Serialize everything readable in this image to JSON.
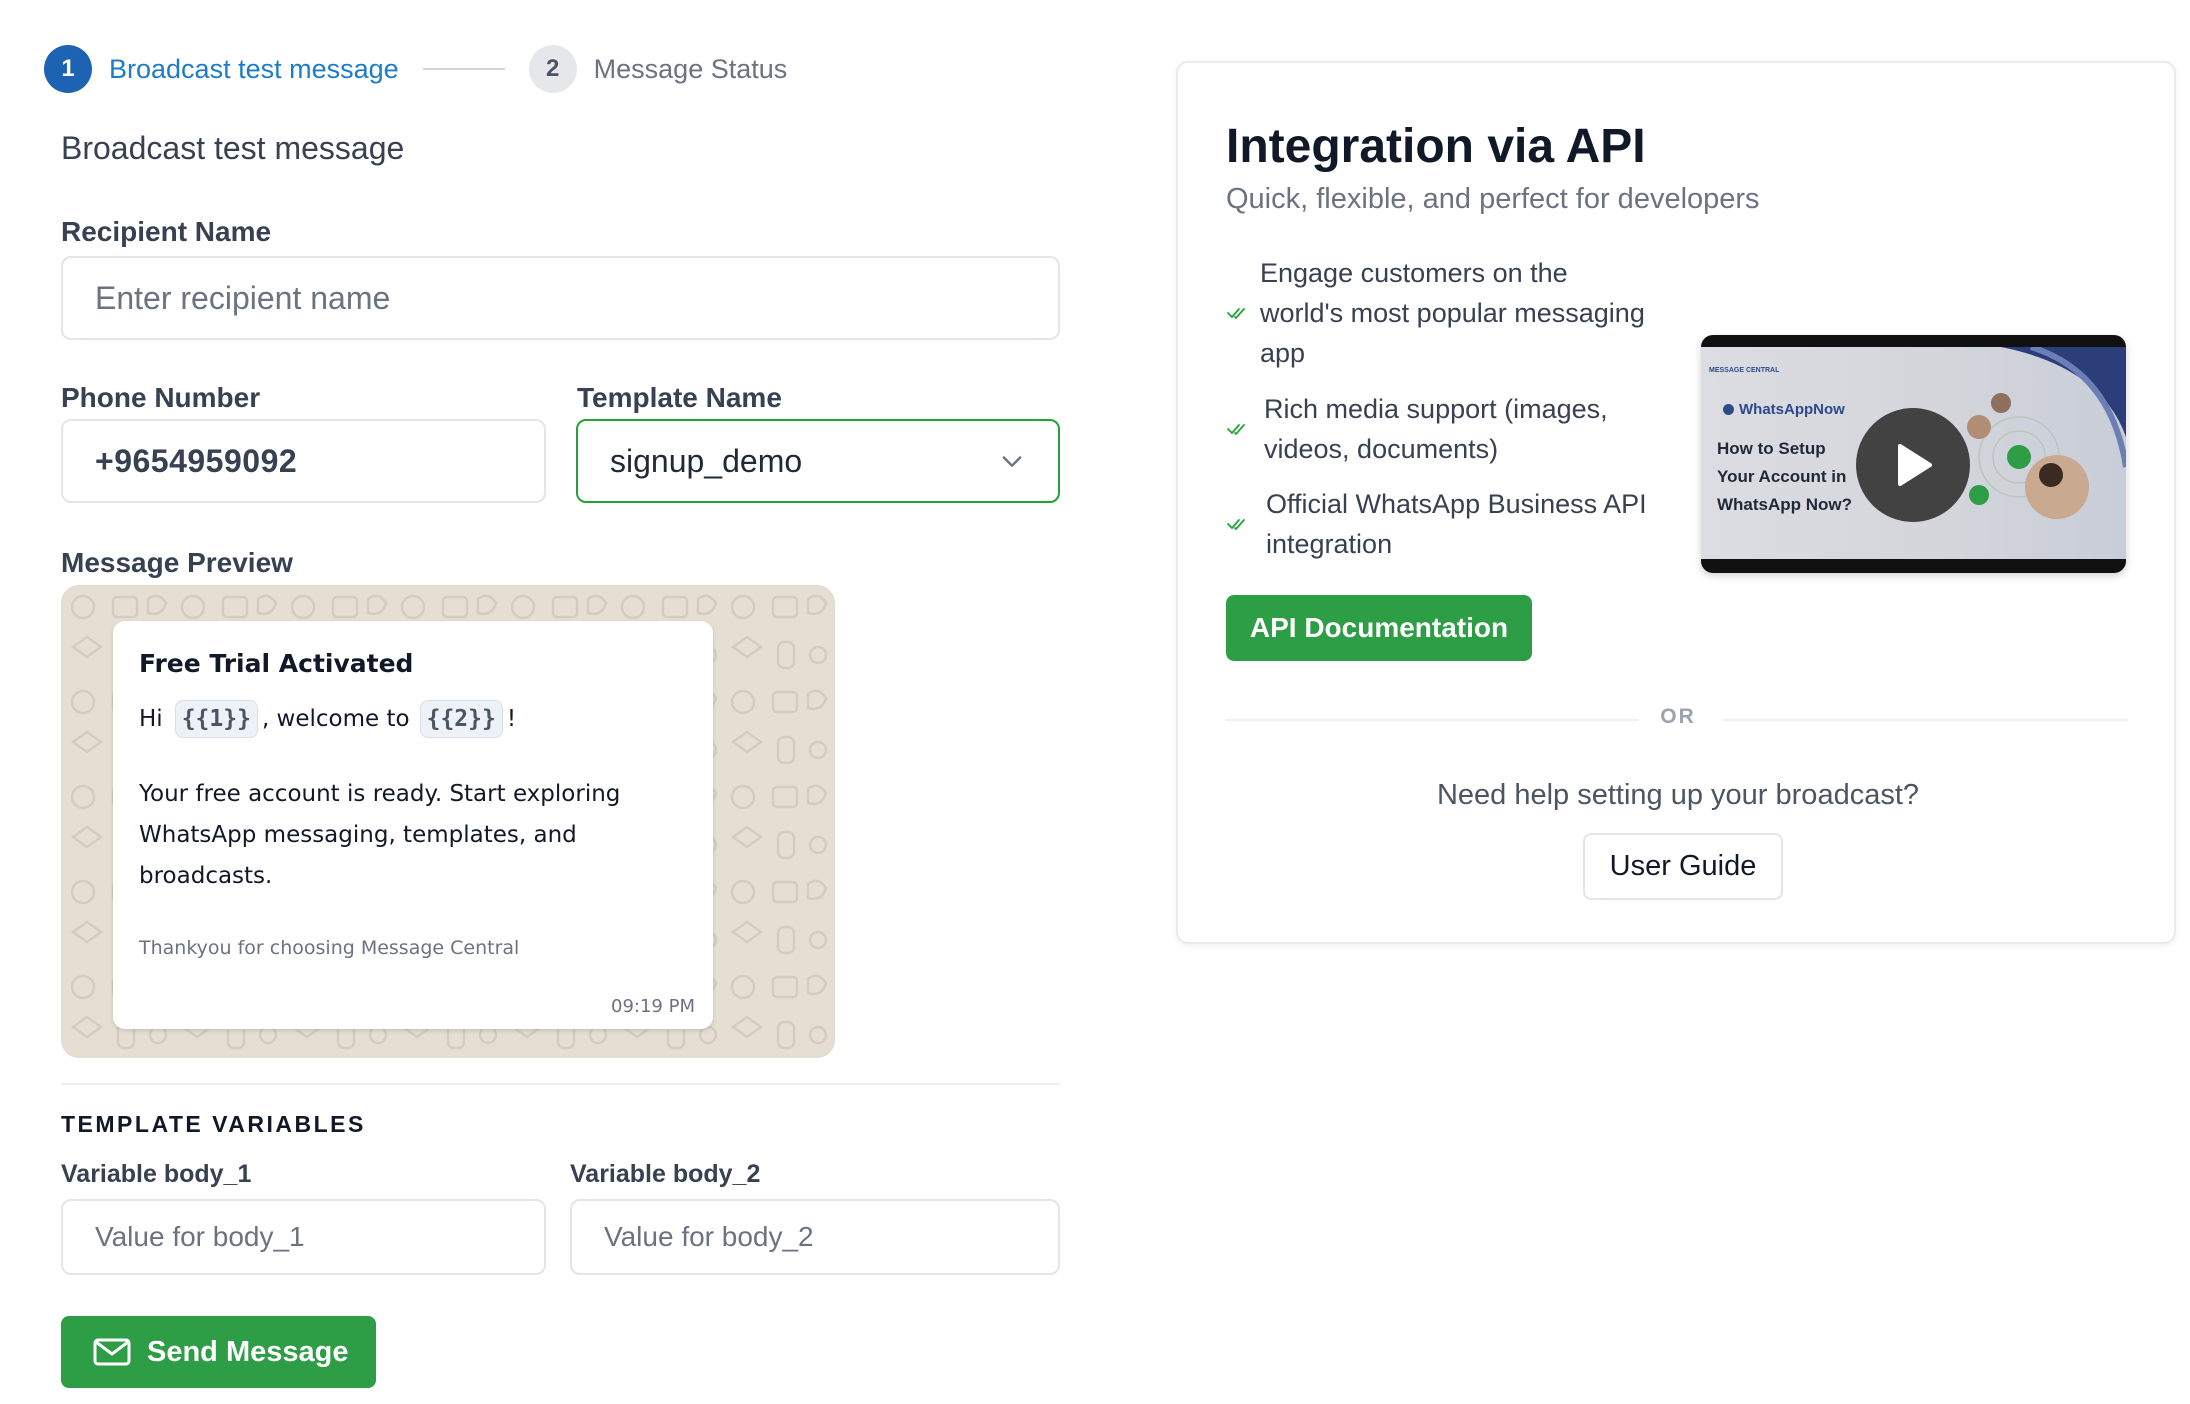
{
  "stepper": {
    "steps": [
      {
        "number": "1",
        "label": "Broadcast test message"
      },
      {
        "number": "2",
        "label": "Message Status"
      }
    ]
  },
  "form": {
    "section_title": "Broadcast test message",
    "recipient_label": "Recipient Name",
    "recipient_placeholder": "Enter recipient name",
    "phone_label": "Phone Number",
    "phone_value": "+9654959092",
    "template_label": "Template Name",
    "template_selected": "signup_demo",
    "preview_label": "Message Preview"
  },
  "preview": {
    "title": "Free Trial Activated",
    "greeting_prefix": "Hi",
    "var1": "{{1}}",
    "greeting_middle": ", welcome to",
    "var2": "{{2}}",
    "greeting_suffix": "!",
    "body": "Your free account is ready. Start exploring WhatsApp messaging, templates, and broadcasts.",
    "footer": "Thankyou for choosing Message Central",
    "time": "09:19 PM"
  },
  "variables": {
    "section_title": "TEMPLATE VARIABLES",
    "body1_label": "Variable body_1",
    "body1_placeholder": "Value for body_1",
    "body2_label": "Variable body_2",
    "body2_placeholder": "Value for body_2"
  },
  "send_button": "Send Message",
  "api_card": {
    "title": "Integration via API",
    "subtitle": "Quick, flexible, and perfect for developers",
    "features": [
      "Engage customers on the world's most popular messaging app",
      "Rich media support (images, videos, documents)",
      "Official WhatsApp Business API integration"
    ],
    "video": {
      "brand": "WhatsAppNow",
      "title_line1": "How to Setup",
      "title_line2": "Your Account in",
      "title_line3": "WhatsApp Now?",
      "corner_text": "MESSAGE CENTRAL"
    },
    "docs_button": "API Documentation",
    "or_text": "OR",
    "help_text": "Need help setting up your broadcast?",
    "guide_button": "User Guide"
  },
  "colors": {
    "primary_blue": "#1d63b4",
    "brand_green": "#2e9e46",
    "select_border_green": "#22a33a"
  },
  "icons": {
    "chevron": "chevron-down-icon",
    "send": "mail-icon",
    "play": "play-icon",
    "check": "double-check-icon"
  }
}
